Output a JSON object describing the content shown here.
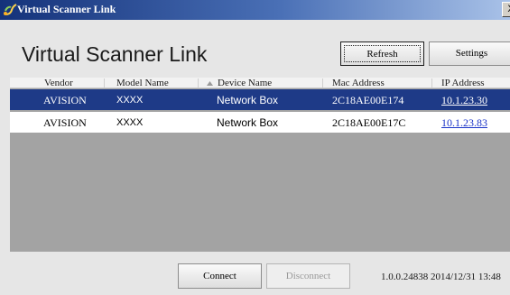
{
  "window": {
    "title": "Virtual Scanner Link",
    "close_label": "X"
  },
  "header": {
    "app_title": "Virtual Scanner Link",
    "refresh_label": "Refresh",
    "settings_label": "Settings"
  },
  "table": {
    "columns": [
      "Vendor",
      "Model Name",
      "Device Name",
      "Mac Address",
      "IP Address"
    ],
    "sorted_column": "Device Name",
    "rows": [
      {
        "vendor": "AVISION",
        "model": "XXXX",
        "device": "Network Box",
        "mac": "2C18AE00E174",
        "ip": "10.1.23.30",
        "selected": true
      },
      {
        "vendor": "AVISION",
        "model": "XXXX",
        "device": "Network Box",
        "mac": "2C18AE00E17C",
        "ip": "10.1.23.83",
        "selected": false
      }
    ]
  },
  "footer": {
    "connect_label": "Connect",
    "disconnect_label": "Disconnect",
    "status_text": "1.0.0.24838  2014/12/31 13:48"
  },
  "colors": {
    "title_bar": "#14327a",
    "selected_row": "#1e3a87",
    "list_background": "#a3a3a3",
    "link": "#1a33c8"
  },
  "icons": {
    "title": "scanner-link-icon",
    "sort": "sort-ascending-icon"
  }
}
